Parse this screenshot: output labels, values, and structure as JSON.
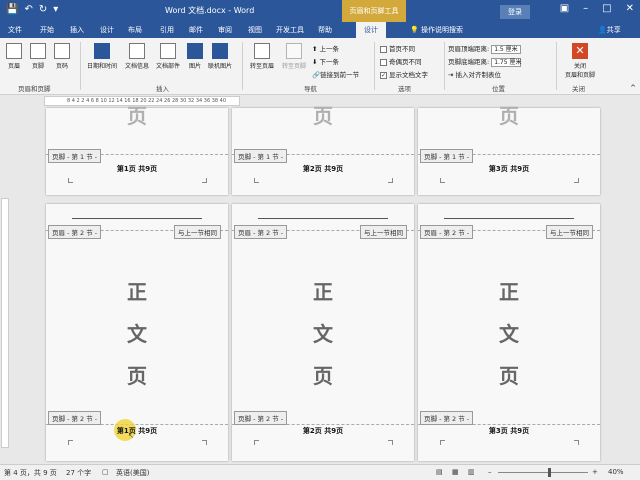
{
  "titlebar": {
    "doc_title": "Word 文档.docx - Word",
    "tools_tab_title": "页眉和页脚工具",
    "login_label": "登录"
  },
  "tabs": {
    "file": "文件",
    "home": "开始",
    "insert": "插入",
    "design_main": "设计",
    "layout": "布局",
    "references": "引用",
    "mailings": "邮件",
    "review": "审阅",
    "view": "视图",
    "developer": "开发工具",
    "help": "帮助",
    "design_hf": "设计",
    "tell_me": "操作说明搜索",
    "share": "共享"
  },
  "ribbon": {
    "header_btn": "页眉",
    "footer_btn": "页脚",
    "pagenum_btn": "页码",
    "group_hf": "页眉和页脚",
    "datetime_btn": "日期和时间",
    "docinfo_btn": "文档信息",
    "quickparts_btn": "文档部件",
    "picture_btn": "图片",
    "onlinepic_btn": "联机图片",
    "group_insert": "插入",
    "goto_header_btn": "转至页眉",
    "goto_footer_btn": "转至页脚",
    "prev_btn": "上一条",
    "next_btn": "下一条",
    "link_prev_btn": "链接到前一节",
    "group_nav": "导航",
    "first_page_diff": "首页不同",
    "odd_even_diff": "奇偶页不同",
    "show_doc_text": "显示文档文字",
    "group_options": "选项",
    "header_top_label": "页眉顶端距离:",
    "header_top_value": "1.5 厘米",
    "footer_bottom_label": "页脚底端距离:",
    "footer_bottom_value": "1.75 厘米",
    "insert_align_tab": "插入对齐制表位",
    "group_position": "位置",
    "close_btn_line1": "关闭",
    "close_btn_line2": "页眉和页脚",
    "group_close": "关闭"
  },
  "ruler_text": "8 4 2   2  4  6  8 10 12 14 16 18 20 22 24 26 28 30 32 34 36 38 40",
  "row1": [
    {
      "footer_tag": "页脚 - 第 1 节 -",
      "page_label": "第1页  共9页",
      "header_char": "页"
    },
    {
      "footer_tag": "页脚 - 第 1 节 -",
      "page_label": "第2页  共9页",
      "header_char": "页"
    },
    {
      "footer_tag": "页脚 - 第 1 节 -",
      "page_label": "第3页  共9页",
      "header_char": "页"
    }
  ],
  "row2": [
    {
      "header_tag": "页眉 - 第 2 节 -",
      "same_tag": "与上一节相同",
      "footer_tag": "页脚 - 第 2 节 -",
      "page_label": "第1页  共9页",
      "chars": [
        "正",
        "文",
        "页"
      ]
    },
    {
      "header_tag": "页眉 - 第 2 节 -",
      "same_tag": "与上一节相同",
      "footer_tag": "页脚 - 第 2 节 -",
      "page_label": "第2页  共9页",
      "chars": [
        "正",
        "文",
        "页"
      ]
    },
    {
      "header_tag": "页眉 - 第 2 节 -",
      "same_tag": "与上一节相同",
      "footer_tag": "页脚 - 第 2 节 -",
      "page_label": "第3页  共9页",
      "chars": [
        "正",
        "文",
        "页"
      ]
    }
  ],
  "status": {
    "page_info": "第 4 页，共 9 页",
    "word_count": "27 个字",
    "language": "英语(美国)",
    "zoom": "40%"
  }
}
